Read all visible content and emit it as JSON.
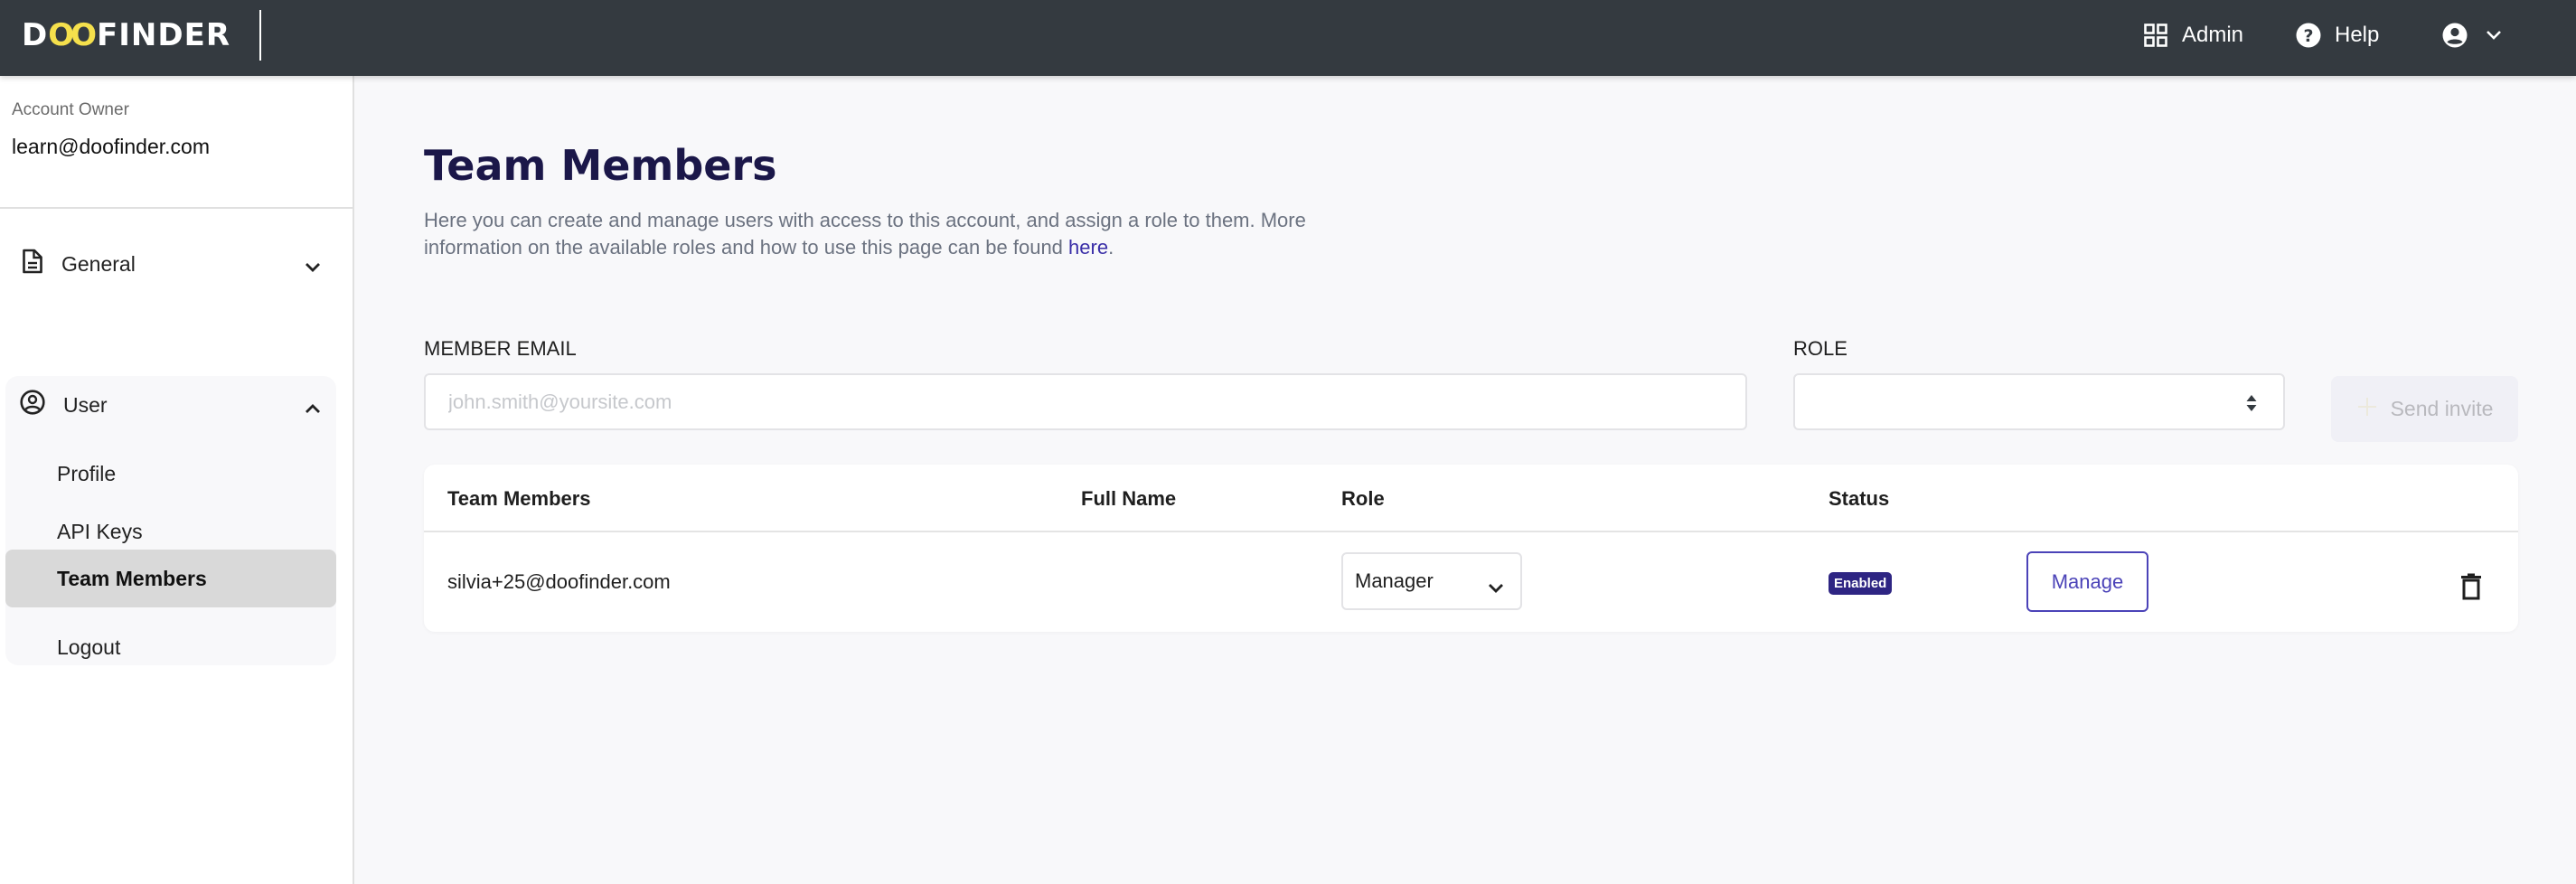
{
  "header": {
    "logo": {
      "prefix": "D",
      "accent": "OO",
      "suffix": "FINDER"
    },
    "nav": [
      {
        "label": "Admin",
        "icon": "grid-icon"
      },
      {
        "label": "Help",
        "icon": "help-circle-icon"
      },
      {
        "label": "",
        "icon": "account-circle-icon"
      }
    ]
  },
  "sidebar": {
    "account_label": "Account Owner",
    "account_email": "learn@doofinder.com",
    "sections": [
      {
        "label": "General",
        "icon": "document-icon",
        "expanded": false
      },
      {
        "label": "User",
        "icon": "user-circle-icon",
        "expanded": true,
        "items": [
          {
            "label": "Profile",
            "active": false
          },
          {
            "label": "API Keys",
            "active": false
          },
          {
            "label": "Team Members",
            "active": true
          },
          {
            "label": "Logout",
            "active": false
          }
        ]
      }
    ]
  },
  "main": {
    "title": "Team Members",
    "description": "Here you can create and manage users with access to this account, and assign a role to them. More information on the available roles and how to use this page can be found ",
    "description_link": "here",
    "description_end": ".",
    "form": {
      "email_label": "MEMBER EMAIL",
      "email_placeholder": "john.smith@yoursite.com",
      "email_value": "",
      "role_label": "ROLE",
      "role_value": "",
      "send_label": "Send invite"
    },
    "table": {
      "columns": [
        "Team Members",
        "Full Name",
        "Role",
        "Status"
      ],
      "rows": [
        {
          "email": "silvia+25@doofinder.com",
          "full_name": "",
          "role": "Manager",
          "status": "Enabled",
          "action": "Manage"
        }
      ]
    }
  },
  "colors": {
    "header_bg": "#343a40",
    "logo_accent": "#f5e04c",
    "title": "#1b1749",
    "link": "#3b2fa8",
    "badge_bg": "#2e2583",
    "manage_accent": "#4b43b8"
  }
}
